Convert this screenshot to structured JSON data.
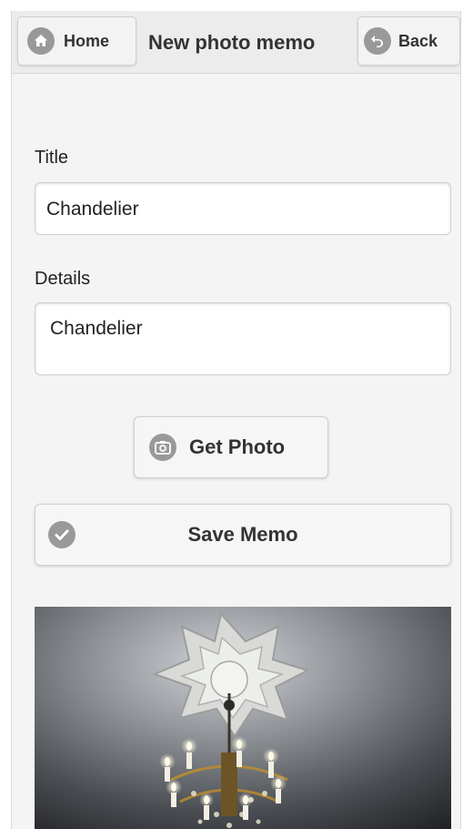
{
  "header": {
    "home_label": "Home",
    "title": "New photo memo",
    "back_label": "Back"
  },
  "form": {
    "title_label": "Title",
    "title_value": "Chandelier",
    "details_label": "Details",
    "details_value": "Chandelier"
  },
  "actions": {
    "get_photo_label": "Get Photo",
    "save_label": "Save Memo"
  },
  "icons": {
    "home": "home-icon",
    "back": "back-arrow-icon",
    "camera": "camera-icon",
    "check": "check-icon"
  },
  "colors": {
    "header_bg": "#ececec",
    "icon_gray": "#999999",
    "page_bg": "#f4f4f4"
  }
}
